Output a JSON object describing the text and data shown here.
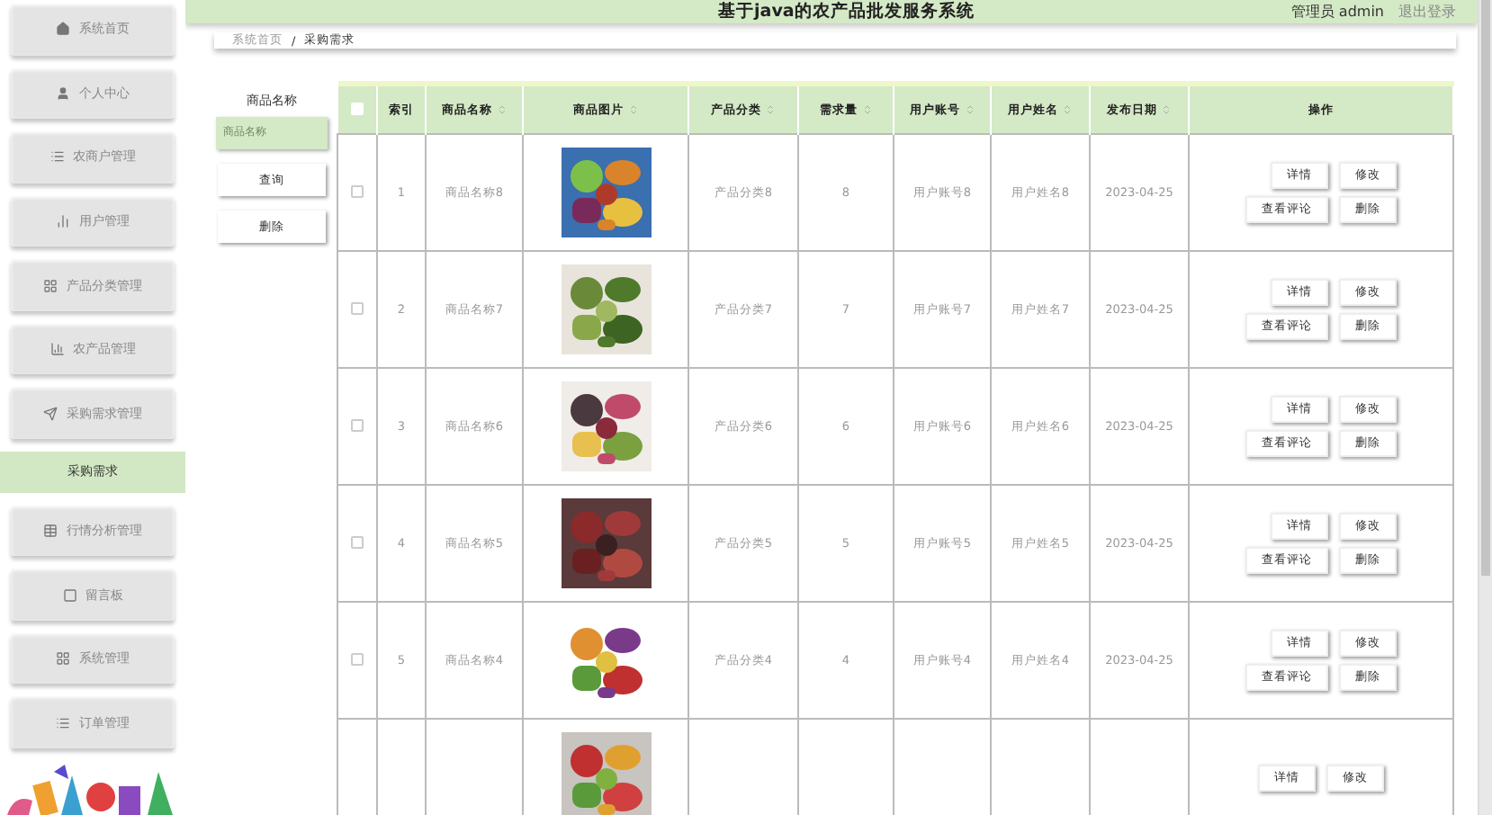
{
  "sidebar": {
    "items": [
      {
        "label": "系统首页",
        "selected": false
      },
      {
        "label": "个人中心",
        "selected": false
      },
      {
        "label": "农商户管理",
        "selected": false
      },
      {
        "label": "用户管理",
        "selected": false
      },
      {
        "label": "产品分类管理",
        "selected": false
      },
      {
        "label": "农产品管理",
        "selected": false
      },
      {
        "label": "采购需求管理",
        "selected": false
      },
      {
        "label": "采购需求",
        "kind": "sub",
        "selected": true
      },
      {
        "label": "行情分析管理",
        "selected": false
      },
      {
        "label": "留言板",
        "selected": false
      },
      {
        "label": "系统管理",
        "selected": false
      },
      {
        "label": "订单管理",
        "selected": false
      }
    ]
  },
  "header": {
    "title": "基于java的农产品批发服务系统",
    "user": "管理员 admin",
    "logout": "退出登录"
  },
  "breadcrumb": {
    "items": [
      "系统首页",
      "采购需求"
    ],
    "separator": "/"
  },
  "search": {
    "label": "商品名称",
    "placeholder": "商品名称",
    "buttons": [
      "查询",
      "删除"
    ]
  },
  "table": {
    "select_all_checked": false,
    "columns": [
      {
        "label": "索引",
        "sortable": false
      },
      {
        "label": "商品名称",
        "sortable": true
      },
      {
        "label": "商品图片",
        "sortable": true
      },
      {
        "label": "产品分类",
        "sortable": true
      },
      {
        "label": "需求量",
        "sortable": true
      },
      {
        "label": "用户账号",
        "sortable": true
      },
      {
        "label": "用户姓名",
        "sortable": true
      },
      {
        "label": "发布日期",
        "sortable": true
      },
      {
        "label": "操作",
        "sortable": false
      }
    ],
    "rows": [
      {
        "kind": "full",
        "cells": [
          "1",
          "商品名称8",
          null,
          "产品分类8",
          "8",
          "用户账号8",
          "用户姓名8",
          "2023-04-25"
        ],
        "image": {
          "kind": "picture"
        },
        "checked": false,
        "actions": [
          "详情",
          "修改",
          "查看评论",
          "删除"
        ]
      },
      {
        "kind": "full",
        "cells": [
          "2",
          "商品名称7",
          null,
          "产品分类7",
          "7",
          "用户账号7",
          "用户姓名7",
          "2023-04-25"
        ],
        "image": {
          "kind": "picture"
        },
        "checked": false,
        "actions": [
          "详情",
          "修改",
          "查看评论",
          "删除"
        ]
      },
      {
        "kind": "full",
        "cells": [
          "3",
          "商品名称6",
          null,
          "产品分类6",
          "6",
          "用户账号6",
          "用户姓名6",
          "2023-04-25"
        ],
        "image": {
          "kind": "picture"
        },
        "checked": false,
        "actions": [
          "详情",
          "修改",
          "查看评论",
          "删除"
        ]
      },
      {
        "kind": "full",
        "cells": [
          "4",
          "商品名称5",
          null,
          "产品分类5",
          "5",
          "用户账号5",
          "用户姓名5",
          "2023-04-25"
        ],
        "image": {
          "kind": "picture"
        },
        "checked": false,
        "actions": [
          "详情",
          "修改",
          "查看评论",
          "删除"
        ]
      },
      {
        "kind": "full",
        "cells": [
          "5",
          "商品名称4",
          null,
          "产品分类4",
          "4",
          "用户账号4",
          "用户姓名4",
          "2023-04-25"
        ],
        "image": {
          "kind": "picture"
        },
        "checked": false,
        "actions": [
          "详情",
          "修改",
          "查看评论",
          "删除"
        ]
      },
      {
        "kind": "partial",
        "image": {
          "kind": "picture"
        },
        "actions": [
          "详情",
          "修改"
        ]
      }
    ]
  }
}
